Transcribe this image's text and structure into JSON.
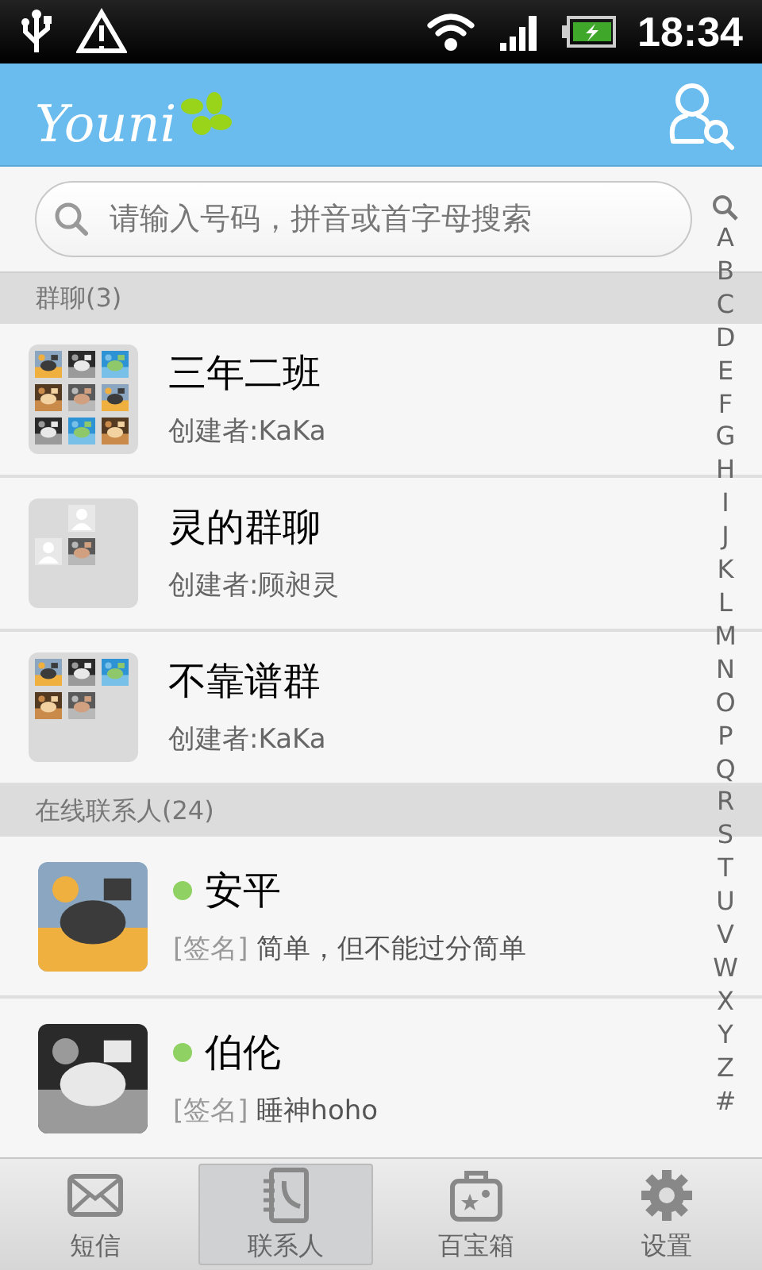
{
  "status_bar": {
    "time": "18:34"
  },
  "header": {
    "logo": "Youni"
  },
  "search": {
    "placeholder": "请输入号码，拼音或首字母搜索"
  },
  "index_bar": {
    "letters": [
      "A",
      "B",
      "C",
      "D",
      "E",
      "F",
      "G",
      "H",
      "I",
      "J",
      "K",
      "L",
      "M",
      "N",
      "O",
      "P",
      "Q",
      "R",
      "S",
      "T",
      "U",
      "V",
      "W",
      "X",
      "Y",
      "Z",
      "#"
    ]
  },
  "sections": [
    {
      "title": "群聊(3)",
      "kind": "groups",
      "items": [
        {
          "name": "三年二班",
          "subtitle": "创建者:KaKa",
          "tiles": [
            {
              "kind": "picture"
            },
            {
              "kind": "picture"
            },
            {
              "kind": "picture"
            },
            {
              "kind": "picture"
            },
            {
              "kind": "picture"
            },
            {
              "kind": "picture"
            },
            {
              "kind": "picture"
            },
            {
              "kind": "picture"
            },
            {
              "kind": "picture"
            }
          ]
        },
        {
          "name": "灵的群聊",
          "subtitle": "创建者:顾昶灵",
          "tiles": [
            {
              "kind": "placeholder"
            },
            {
              "kind": "placeholder"
            },
            {
              "kind": "picture"
            }
          ]
        },
        {
          "name": "不靠谱群",
          "subtitle": "创建者:KaKa",
          "tiles": [
            {
              "kind": "picture"
            },
            {
              "kind": "picture"
            },
            {
              "kind": "picture"
            },
            {
              "kind": "picture"
            },
            {
              "kind": "picture"
            }
          ]
        }
      ]
    },
    {
      "title": "在线联系人(24)",
      "kind": "contacts",
      "items": [
        {
          "name": "安平",
          "online": true,
          "tag": "[签名]",
          "signature": "简单，但不能过分简单"
        },
        {
          "name": "伯伦",
          "online": true,
          "tag": "[签名]",
          "signature": "睡神hoho"
        }
      ]
    }
  ],
  "tabs": [
    {
      "label": "短信",
      "selected": false
    },
    {
      "label": "联系人",
      "selected": true
    },
    {
      "label": "百宝箱",
      "selected": false
    },
    {
      "label": "设置",
      "selected": false
    }
  ]
}
